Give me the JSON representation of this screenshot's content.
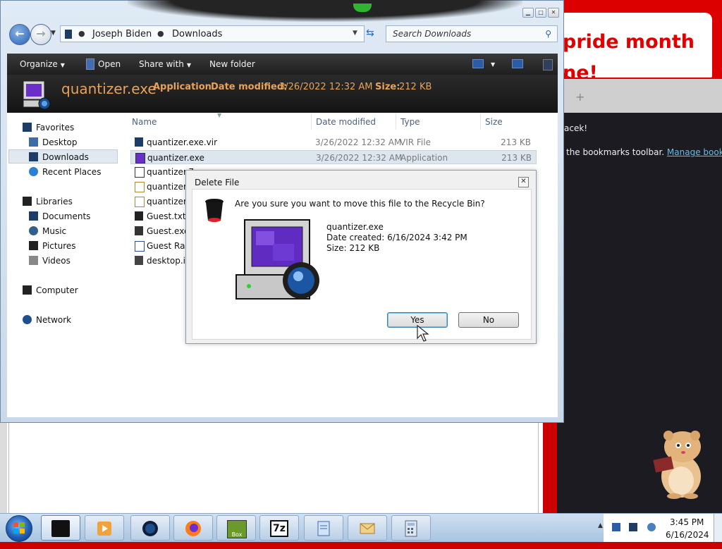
{
  "background_browser": {
    "banner_line1": "pride month",
    "banner_line2": "ne!",
    "tab_plus": "+",
    "user_line": "acek!",
    "bookmark_text": " the bookmarks toolbar. ",
    "bookmark_link": "Manage bookmarks"
  },
  "explorer": {
    "address": {
      "crumbs": [
        "Joseph Biden",
        "Downloads"
      ]
    },
    "search_placeholder": "Search Downloads",
    "toolbar": {
      "organize": "Organize",
      "open": "Open",
      "share_with": "Share with",
      "new_folder": "New folder"
    },
    "details": {
      "name": "quantizer.exe",
      "type": "Application",
      "modified_label": "Date modified:",
      "modified_value": "3/26/2022 12:32 AM",
      "size_label": "Size:",
      "size_value": "212 KB"
    },
    "nav": {
      "favorites": "Favorites",
      "desktop": "Desktop",
      "downloads": "Downloads",
      "recent": "Recent Places",
      "libraries": "Libraries",
      "documents": "Documents",
      "music": "Music",
      "pictures": "Pictures",
      "videos": "Videos",
      "computer": "Computer",
      "network": "Network"
    },
    "columns": {
      "name": "Name",
      "date": "Date modified",
      "type": "Type",
      "size": "Size"
    },
    "files": [
      {
        "name": "quantizer.exe.vir",
        "date": "3/26/2022 12:32 AM",
        "type": "VIR File",
        "size": "213 KB"
      },
      {
        "name": "quantizer.exe",
        "date": "3/26/2022 12:32 AM",
        "type": "Application",
        "size": "213 KB"
      },
      {
        "name": "quantizer.7",
        "date": "",
        "type": "",
        "size": ""
      },
      {
        "name": "quantizer(2",
        "date": "",
        "type": "",
        "size": ""
      },
      {
        "name": "quantizer(1",
        "date": "",
        "type": "",
        "size": ""
      },
      {
        "name": "Guest.txt",
        "date": "",
        "type": "",
        "size": ""
      },
      {
        "name": "Guest.exe",
        "date": "",
        "type": "",
        "size": ""
      },
      {
        "name": "Guest Rans",
        "date": "",
        "type": "",
        "size": ""
      },
      {
        "name": "desktop.in",
        "date": "",
        "type": "",
        "size": ""
      }
    ]
  },
  "dialog": {
    "title": "Delete File",
    "close": "✕",
    "question": "Are you sure you want to move this file to the Recycle Bin?",
    "file_name": "quantizer.exe",
    "date_created": "Date created: 6/16/2024 3:42 PM",
    "size": "Size: 212 KB",
    "yes": "Yes",
    "no": "No"
  },
  "taskbar": {
    "time": "3:45 PM",
    "date": "6/16/2024",
    "seven_zip_label": "7z",
    "box_label": "Box"
  },
  "colors": {
    "accent_orange": "#e8a25a",
    "selection": "#dde6ef",
    "banner_red": "#e00000"
  }
}
